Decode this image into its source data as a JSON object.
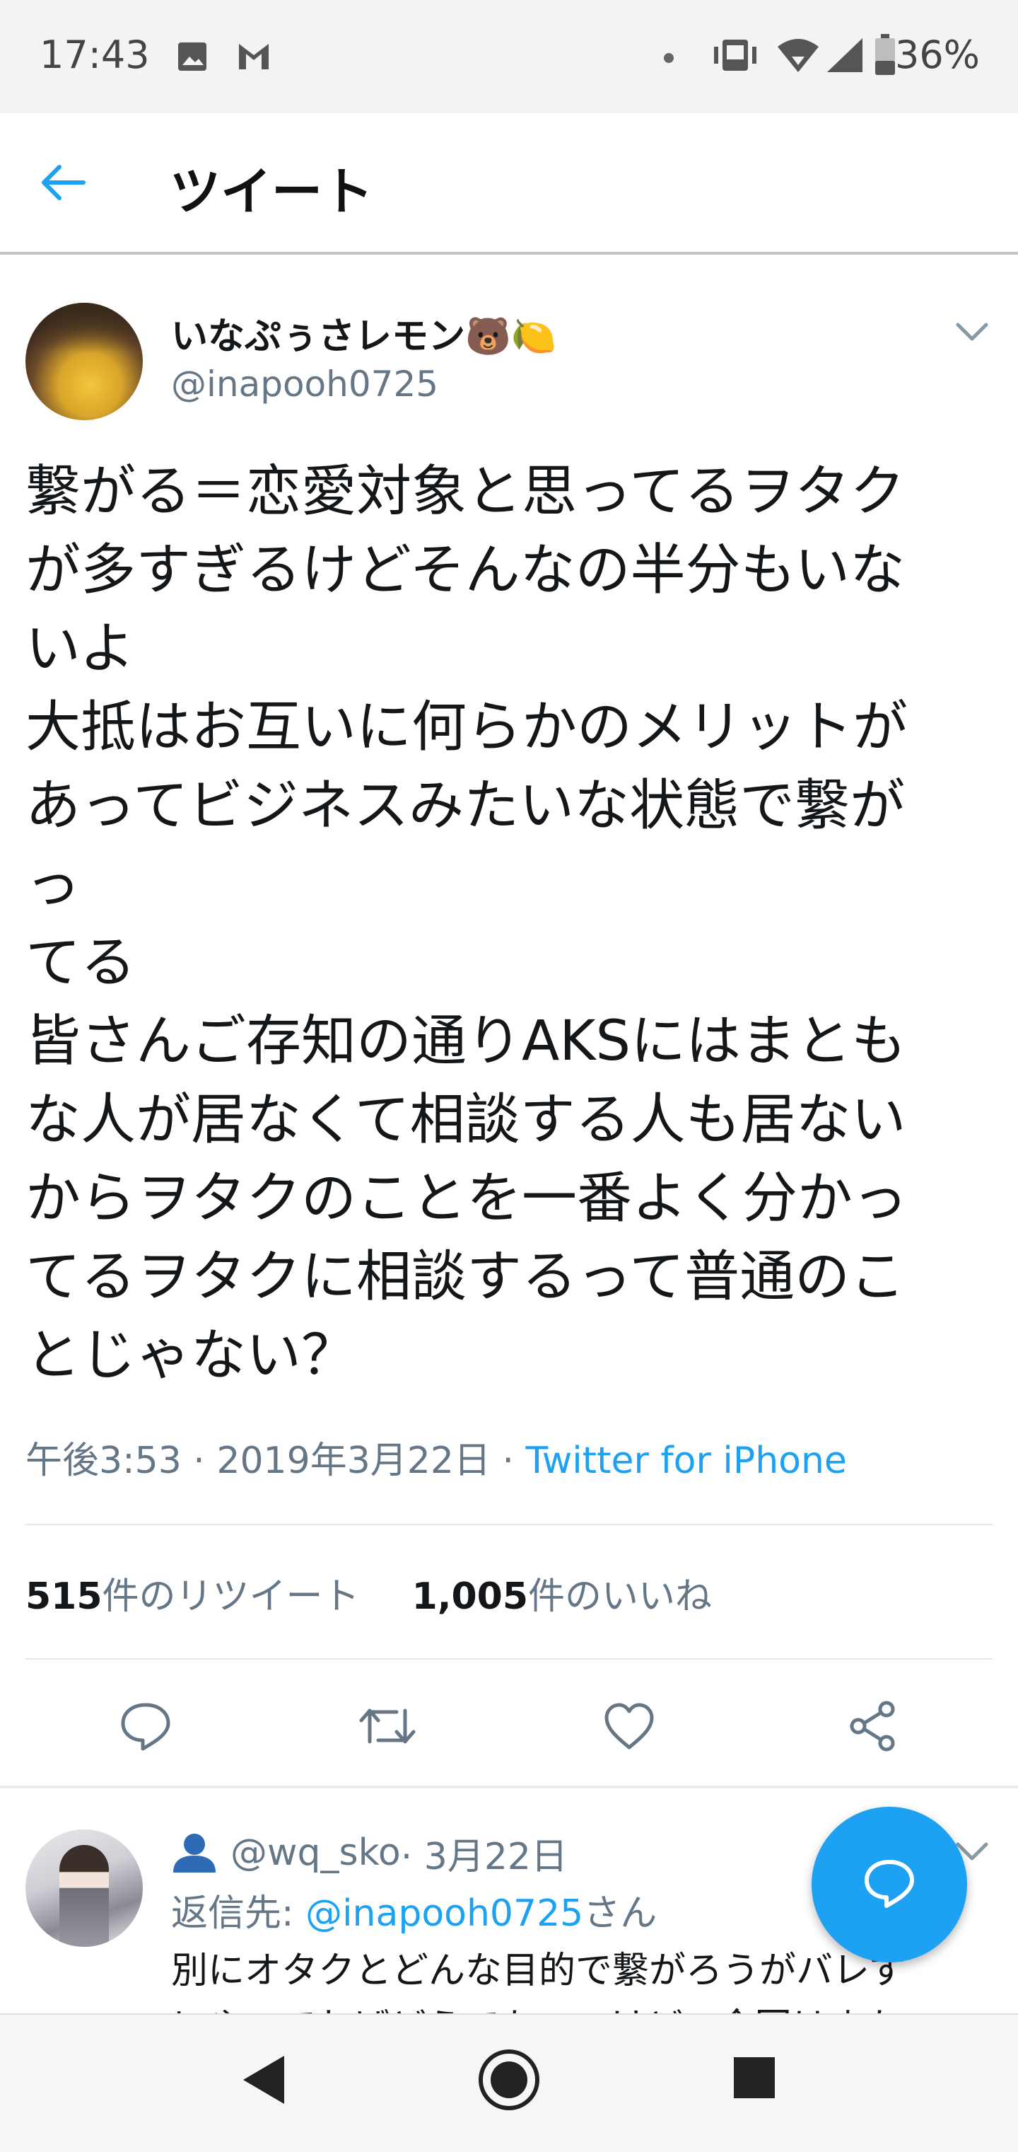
{
  "status_bar": {
    "time": "17:43",
    "battery": "36%",
    "icons": [
      "image-icon",
      "gmail-icon",
      "dot-icon",
      "vibrate-icon",
      "wifi-icon",
      "signal-icon",
      "battery-icon"
    ]
  },
  "header": {
    "back_icon": "arrow-left-icon",
    "title": "ツイート"
  },
  "tweet": {
    "author_name": "いなぷぅさレモン🐻🍋",
    "author_handle": "@inapooh0725",
    "caret_icon": "chevron-down-icon",
    "text_lines": [
      "繋がる＝恋愛対象と思ってるヲタク",
      "が多すぎるけどそんなの半分もいな",
      "いよ",
      "大抵はお互いに何らかのメリットが",
      "あってビジネスみたいな状態で繋が",
      "っ",
      "てる",
      "皆さんご存知の通りAKSにはまとも",
      "な人が居なくて相談する人も居ない",
      "からヲタクのことを一番よく分かっ",
      "てるヲタクに相談するって普通のこ",
      "とじゃない？"
    ],
    "timestamp": "午後3:53 · 2019年3月22日 · ",
    "source": "Twitter for iPhone",
    "retweet_count": "515",
    "retweet_label": "件のリツイート",
    "like_count": "1,005",
    "like_label": "件のいいね",
    "actions": [
      "reply-icon",
      "retweet-icon",
      "like-icon",
      "share-icon"
    ]
  },
  "reply": {
    "user_icon": "person-icon",
    "handle": "@wq_sko",
    "date": " · 3月22日",
    "reply_to_prefix": "返信先: ",
    "reply_to_mention": "@inapooh0725",
    "reply_to_suffix": "さん",
    "text_lines": [
      "別にオタクとどんな目的で繋がろうがバレず",
      "にやってればどうでもいいけど、今回はまた"
    ]
  },
  "fab": {
    "icon": "compose-reply-icon"
  },
  "nav_bar": {
    "icons": [
      "nav-back-icon",
      "nav-home-icon",
      "nav-recents-icon"
    ]
  },
  "colors": {
    "accent": "#1da1f2",
    "secondary_text": "#657786",
    "primary_text": "#14171a"
  }
}
